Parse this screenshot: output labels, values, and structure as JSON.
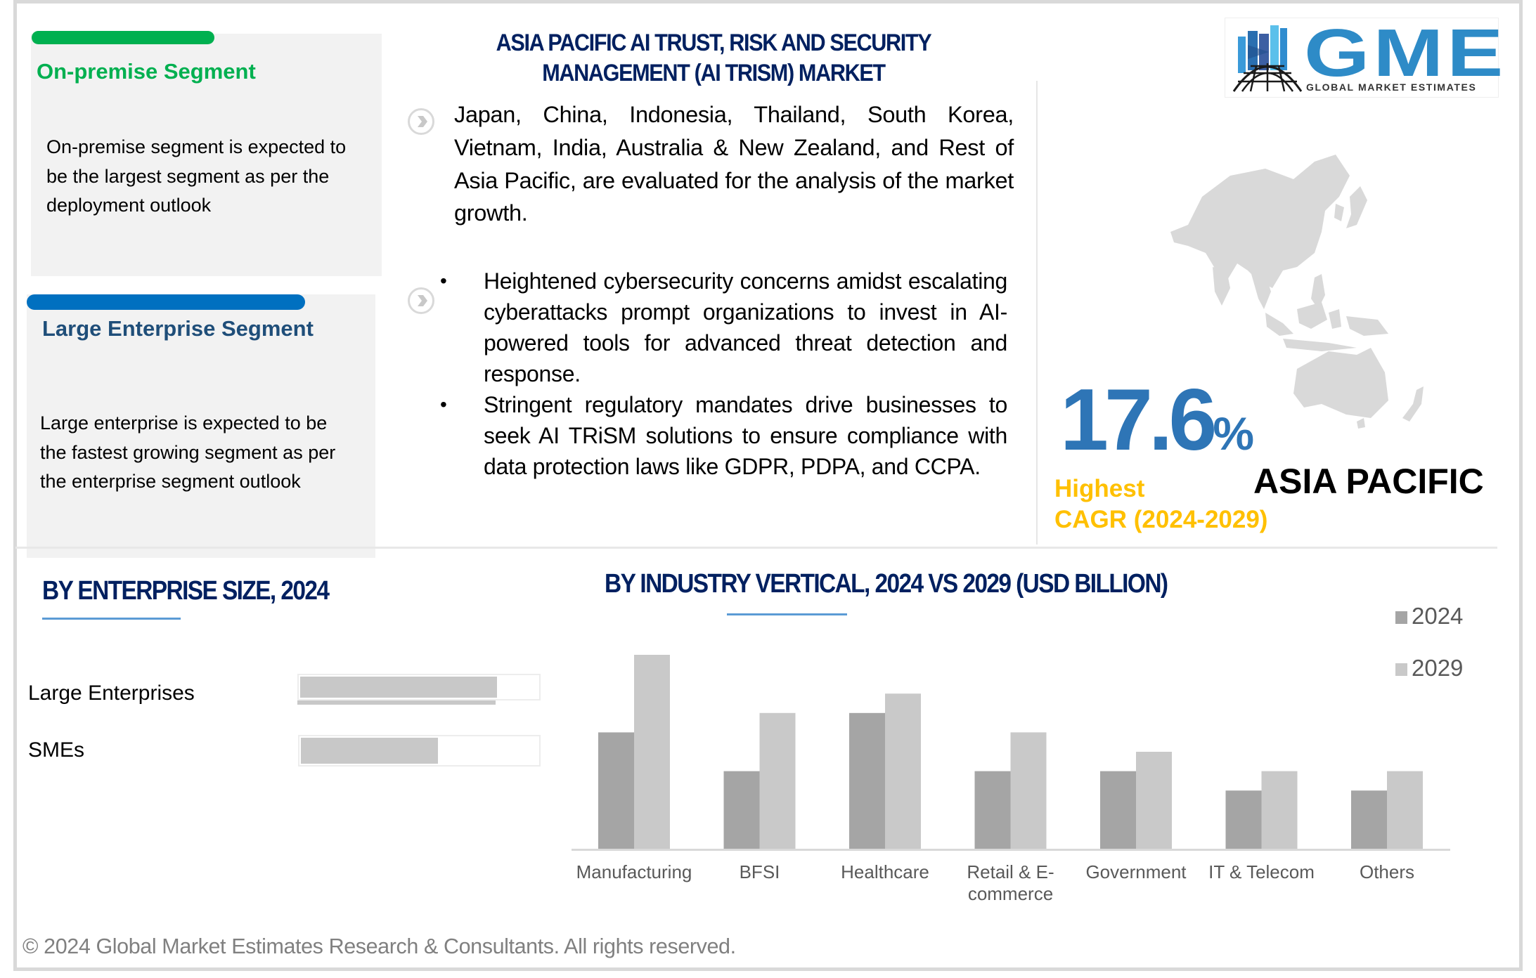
{
  "header": {
    "title_line1": "ASIA PACIFIC AI TRUST, RISK AND SECURITY",
    "title_line2": "MANAGEMENT (AI TRISM) MARKET",
    "logo": {
      "brand": "GME",
      "tagline": "GLOBAL MARKET ESTIMATES"
    }
  },
  "cards": [
    {
      "title": "On-premise Segment",
      "body": "On-premise segment is expected to be the largest segment as per the deployment outlook",
      "accent": "#00b050"
    },
    {
      "title": "Large Enterprise Segment",
      "body": "Large enterprise is expected to be the fastest growing segment as per the enterprise segment outlook",
      "accent": "#0070c0"
    }
  ],
  "overview": {
    "countries_text": "Japan, China, Indonesia, Thailand, South Korea, Vietnam, India, Australia & New Zealand, and Rest of Asia Pacific, are evaluated for the analysis of the market growth.",
    "bullets": [
      "Heightened cybersecurity concerns amidst escalating cyberattacks prompt organizations to invest in AI-powered tools for advanced threat detection and response.",
      "Stringent regulatory mandates drive businesses to seek AI TRiSM solutions to ensure compliance with data protection laws like GDPR, PDPA, and CCPA."
    ]
  },
  "cagr": {
    "value": "17.6",
    "unit": "%",
    "label_line1": "Highest",
    "label_line2": "CAGR (2024-2029)",
    "region": "ASIA PACIFIC",
    "value_color": "#2e75b6",
    "label_color": "#ffc000"
  },
  "chart_data": [
    {
      "type": "bar",
      "orientation": "horizontal",
      "title": "BY  ENTERPRISE SIZE, 2024",
      "categories": [
        "Large Enterprises",
        "SMEs"
      ],
      "values": [
        0.82,
        0.57
      ],
      "value_unit": "relative share (fraction of bar track)",
      "xlabel": "",
      "ylabel": "",
      "grid": false
    },
    {
      "type": "bar",
      "orientation": "vertical",
      "title": "BY INDUSTRY VERTICAL, 2024 VS 2029 (USD BILLION)",
      "categories": [
        "Manufacturing",
        "BFSI",
        "Healthcare",
        "Retail & E-commerce",
        "Government",
        "IT & Telecom",
        "Others"
      ],
      "category_labels": [
        [
          "Manufacturing"
        ],
        [
          "BFSI"
        ],
        [
          "Healthcare"
        ],
        [
          "Retail & E-",
          "commerce"
        ],
        [
          "Government"
        ],
        [
          "IT & Telecom"
        ],
        [
          "Others"
        ]
      ],
      "series": [
        {
          "name": "2024",
          "color": "#a5a5a5",
          "values": [
            6,
            4,
            7,
            4,
            4,
            3,
            3
          ]
        },
        {
          "name": "2029",
          "color": "#c9c9c9",
          "values": [
            10,
            7,
            8,
            6,
            5,
            4,
            4
          ]
        }
      ],
      "value_unit": "relative units (no axis scale shown)",
      "ylim": [
        0,
        10
      ],
      "xlabel": "",
      "ylabel": "",
      "grid": false,
      "legend": "top-right"
    }
  ],
  "footer": {
    "copyright": "© 2024 Global Market Estimates Research & Consultants. All rights reserved."
  }
}
